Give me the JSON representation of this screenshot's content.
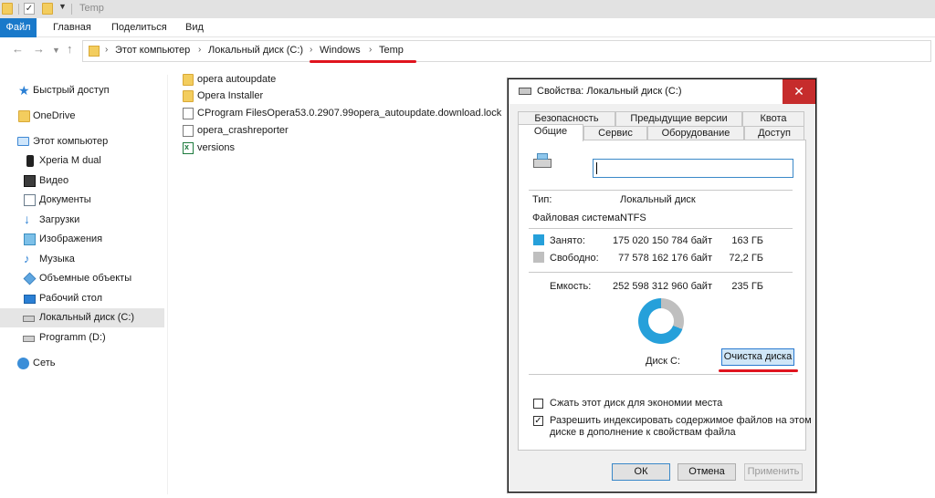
{
  "window": {
    "title": "Temp"
  },
  "ribbon": {
    "tabs": [
      "Файл",
      "Главная",
      "Поделиться",
      "Вид"
    ]
  },
  "address": {
    "crumbs": [
      "Этот компьютер",
      "Локальный диск (C:)",
      "Windows",
      "Temp"
    ]
  },
  "nav": {
    "items": [
      {
        "label": "Быстрый доступ",
        "icon": "star-icon"
      },
      {
        "label": "OneDrive",
        "icon": "folder-icon"
      },
      {
        "label": "Этот компьютер",
        "icon": "computer-icon"
      },
      {
        "label": "Xperia M dual",
        "icon": "phone-icon"
      },
      {
        "label": "Видео",
        "icon": "video-icon"
      },
      {
        "label": "Документы",
        "icon": "documents-icon"
      },
      {
        "label": "Загрузки",
        "icon": "download-icon"
      },
      {
        "label": "Изображения",
        "icon": "pictures-icon"
      },
      {
        "label": "Музыка",
        "icon": "music-icon"
      },
      {
        "label": "Объемные объекты",
        "icon": "3d-objects-icon"
      },
      {
        "label": "Рабочий стол",
        "icon": "desktop-icon"
      },
      {
        "label": "Локальный диск (C:)",
        "icon": "drive-icon"
      },
      {
        "label": "Programm (D:)",
        "icon": "drive-icon"
      },
      {
        "label": "Сеть",
        "icon": "network-icon"
      }
    ]
  },
  "files": [
    {
      "name": "opera autoupdate",
      "icon": "folder-icon"
    },
    {
      "name": "Opera Installer",
      "icon": "folder-icon"
    },
    {
      "name": "CProgram FilesOpera53.0.2907.99opera_autoupdate.download.lock",
      "icon": "file-icon"
    },
    {
      "name": "opera_crashreporter",
      "icon": "text-file-icon"
    },
    {
      "name": "versions",
      "icon": "excel-file-icon"
    }
  ],
  "dialog": {
    "title": "Свойства: Локальный диск (C:)",
    "close": "✕",
    "tabs_top": [
      "Безопасность",
      "Предыдущие версии",
      "Квота"
    ],
    "tabs_bottom": [
      "Общие",
      "Сервис",
      "Оборудование",
      "Доступ"
    ],
    "type_label": "Тип:",
    "type_value": "Локальный диск",
    "fs_label": "Файловая система:",
    "fs_value": "NTFS",
    "used_label": "Занято:",
    "used_bytes": "175 020 150 784 байт",
    "used_gb": "163 ГБ",
    "free_label": "Свободно:",
    "free_bytes": "77 578 162 176 байт",
    "free_gb": "72,2 ГБ",
    "capacity_label": "Емкость:",
    "capacity_bytes": "252 598 312 960 байт",
    "capacity_gb": "235 ГБ",
    "used_fraction": 0.693,
    "used_color": "#26a0da",
    "free_color": "#bfbfbf",
    "disk_label": "Диск C:",
    "cleanup_button": "Очистка диска",
    "compress_checkbox": "Сжать этот диск для экономии места",
    "compress_checked": false,
    "index_checkbox_line1": "Разрешить индексировать содержимое файлов на этом",
    "index_checkbox_line2": "диске в дополнение к свойствам файла",
    "index_checked": true,
    "ok": "ОК",
    "cancel": "Отмена",
    "apply": "Применить"
  },
  "annotation_color": "#e0141e"
}
